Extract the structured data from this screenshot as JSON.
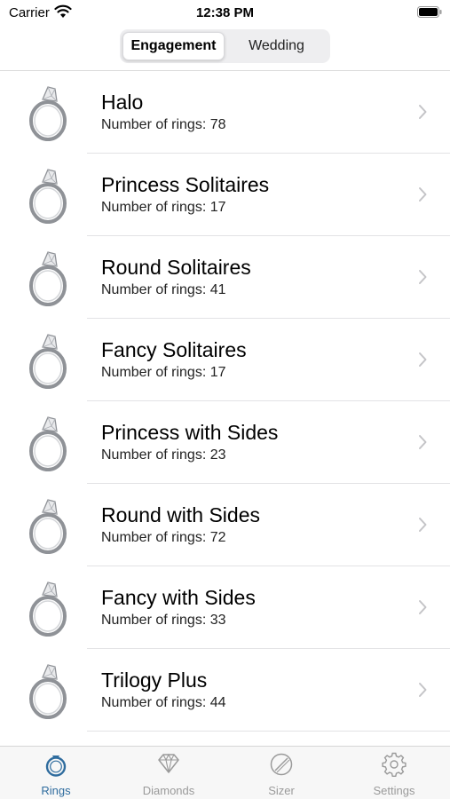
{
  "status_bar": {
    "carrier": "Carrier",
    "time": "12:38 PM"
  },
  "segmented": {
    "options": [
      "Engagement",
      "Wedding"
    ],
    "selected": "Engagement"
  },
  "rings": [
    {
      "title": "Halo",
      "subtitle": "Number of rings: 78"
    },
    {
      "title": "Princess Solitaires",
      "subtitle": "Number of rings: 17"
    },
    {
      "title": "Round Solitaires",
      "subtitle": "Number of rings: 41"
    },
    {
      "title": "Fancy Solitaires",
      "subtitle": "Number of rings: 17"
    },
    {
      "title": "Princess with Sides",
      "subtitle": "Number of rings: 23"
    },
    {
      "title": "Round with Sides",
      "subtitle": "Number of rings: 72"
    },
    {
      "title": "Fancy with Sides",
      "subtitle": "Number of rings: 33"
    },
    {
      "title": "Trilogy Plus",
      "subtitle": "Number of rings: 44"
    }
  ],
  "tabs": [
    {
      "label": "Rings",
      "icon": "ring-icon",
      "active": true
    },
    {
      "label": "Diamonds",
      "icon": "diamond-icon",
      "active": false
    },
    {
      "label": "Sizer",
      "icon": "sizer-icon",
      "active": false
    },
    {
      "label": "Settings",
      "icon": "gear-icon",
      "active": false
    }
  ],
  "colors": {
    "accent": "#2f6c9e",
    "inactive_tab": "#9a9a9a",
    "chevron": "#c4c4c7"
  }
}
